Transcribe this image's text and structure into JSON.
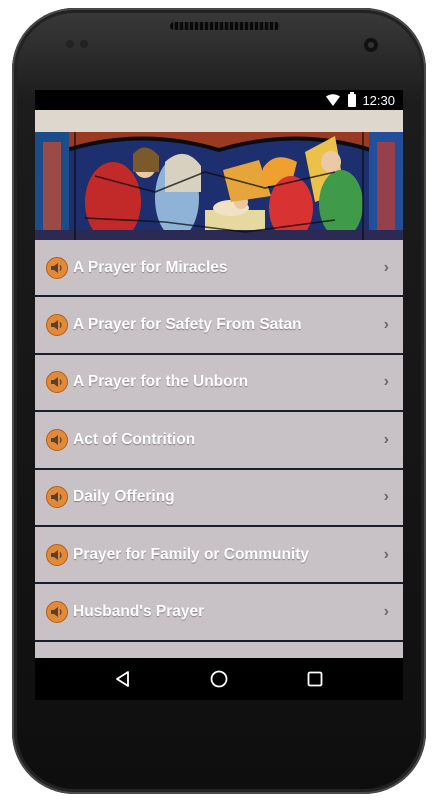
{
  "status_bar": {
    "time": "12:30",
    "icons": [
      "wifi-icon",
      "battery-icon"
    ]
  },
  "prayers": [
    {
      "label": "A Prayer for Miracles",
      "icon": "speaker-icon"
    },
    {
      "label": "A Prayer for Safety From Satan",
      "icon": "speaker-icon"
    },
    {
      "label": "A Prayer for the Unborn",
      "icon": "speaker-icon"
    },
    {
      "label": "Act of Contrition",
      "icon": "speaker-icon"
    },
    {
      "label": "Daily Offering",
      "icon": "speaker-icon"
    },
    {
      "label": "Prayer for Family or Community",
      "icon": "speaker-icon"
    },
    {
      "label": "Husband's Prayer",
      "icon": "speaker-icon"
    }
  ],
  "navigation": [
    "back-icon",
    "home-icon",
    "recents-icon"
  ],
  "colors": {
    "list_background": "#c8c2c7",
    "divider": "#17202b",
    "speaker_icon": "#e08a3a",
    "app_bar": "#ded7cd"
  }
}
